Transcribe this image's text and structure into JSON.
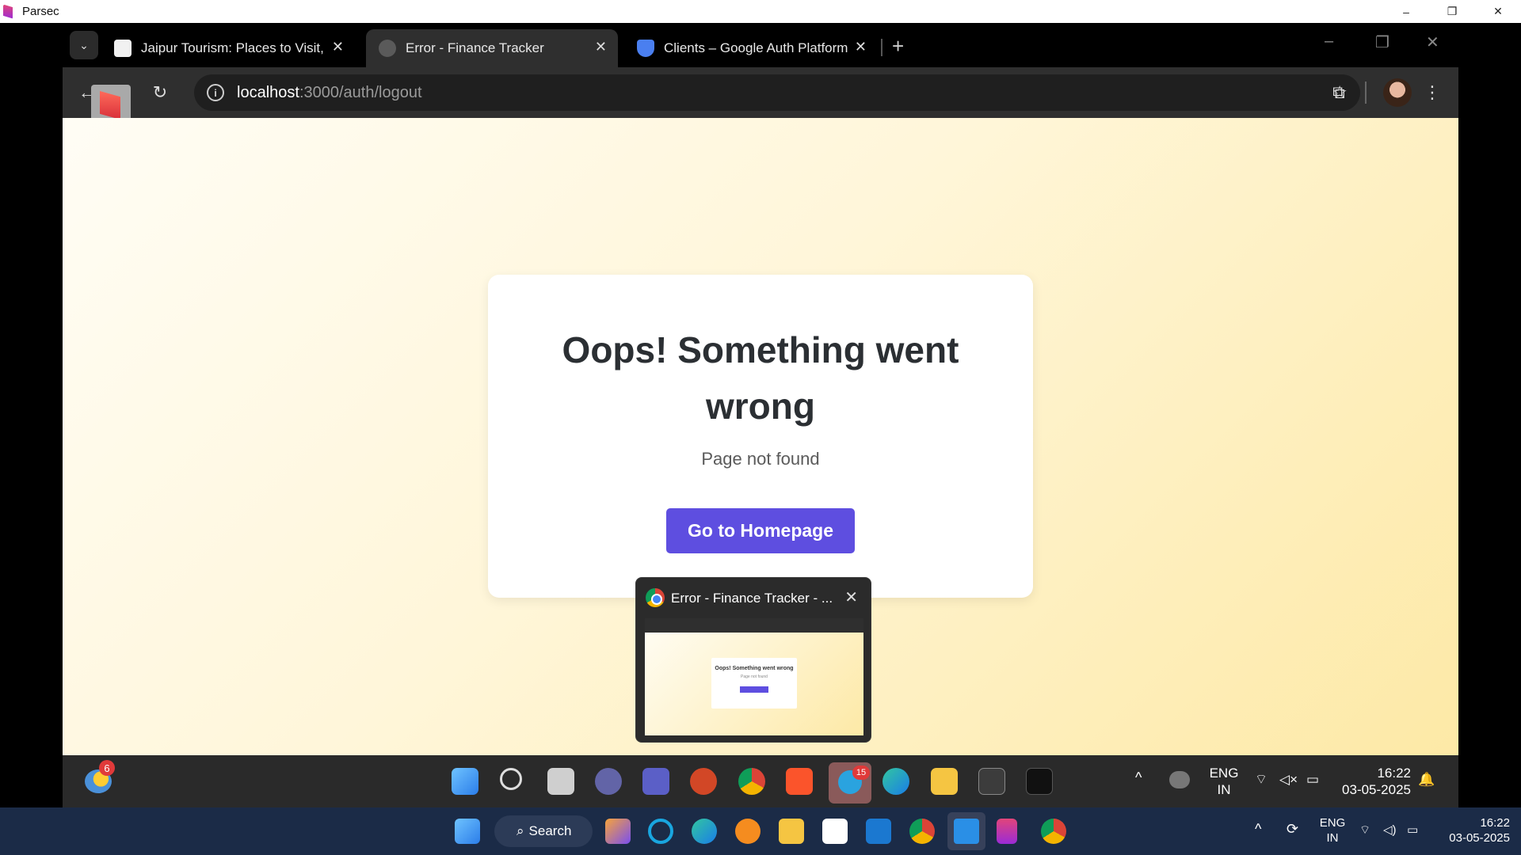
{
  "host": {
    "title": "Parsec",
    "controls": [
      "–",
      "❐",
      "✕"
    ]
  },
  "browser": {
    "tabs": [
      {
        "label": "Jaipur Tourism: Places to Visit, S"
      },
      {
        "label": "Error - Finance Tracker"
      },
      {
        "label": "Clients – Google Auth Platform"
      }
    ],
    "url_host": "localhost",
    "url_path": ":3000/auth/logout"
  },
  "page": {
    "heading": "Oops! Something went wrong",
    "message": "Page not found",
    "button_label": "Go to Homepage"
  },
  "preview": {
    "title": "Error - Finance Tracker - ...",
    "thumb_heading": "Oops! Something went wrong",
    "thumb_msg": "Page not found"
  },
  "remote_taskbar": {
    "weather_badge": "6",
    "telegram_badge": "15",
    "lang_line1": "ENG",
    "lang_line2": "IN",
    "time": "16:22",
    "date": "03-05-2025"
  },
  "host_taskbar": {
    "search_label": "Search",
    "lang_line1": "ENG",
    "lang_line2": "IN",
    "time": "16:22",
    "date": "03-05-2025"
  },
  "colors": {
    "primary_button": "#5e4ee0",
    "page_bg_end": "#fde9a6"
  }
}
